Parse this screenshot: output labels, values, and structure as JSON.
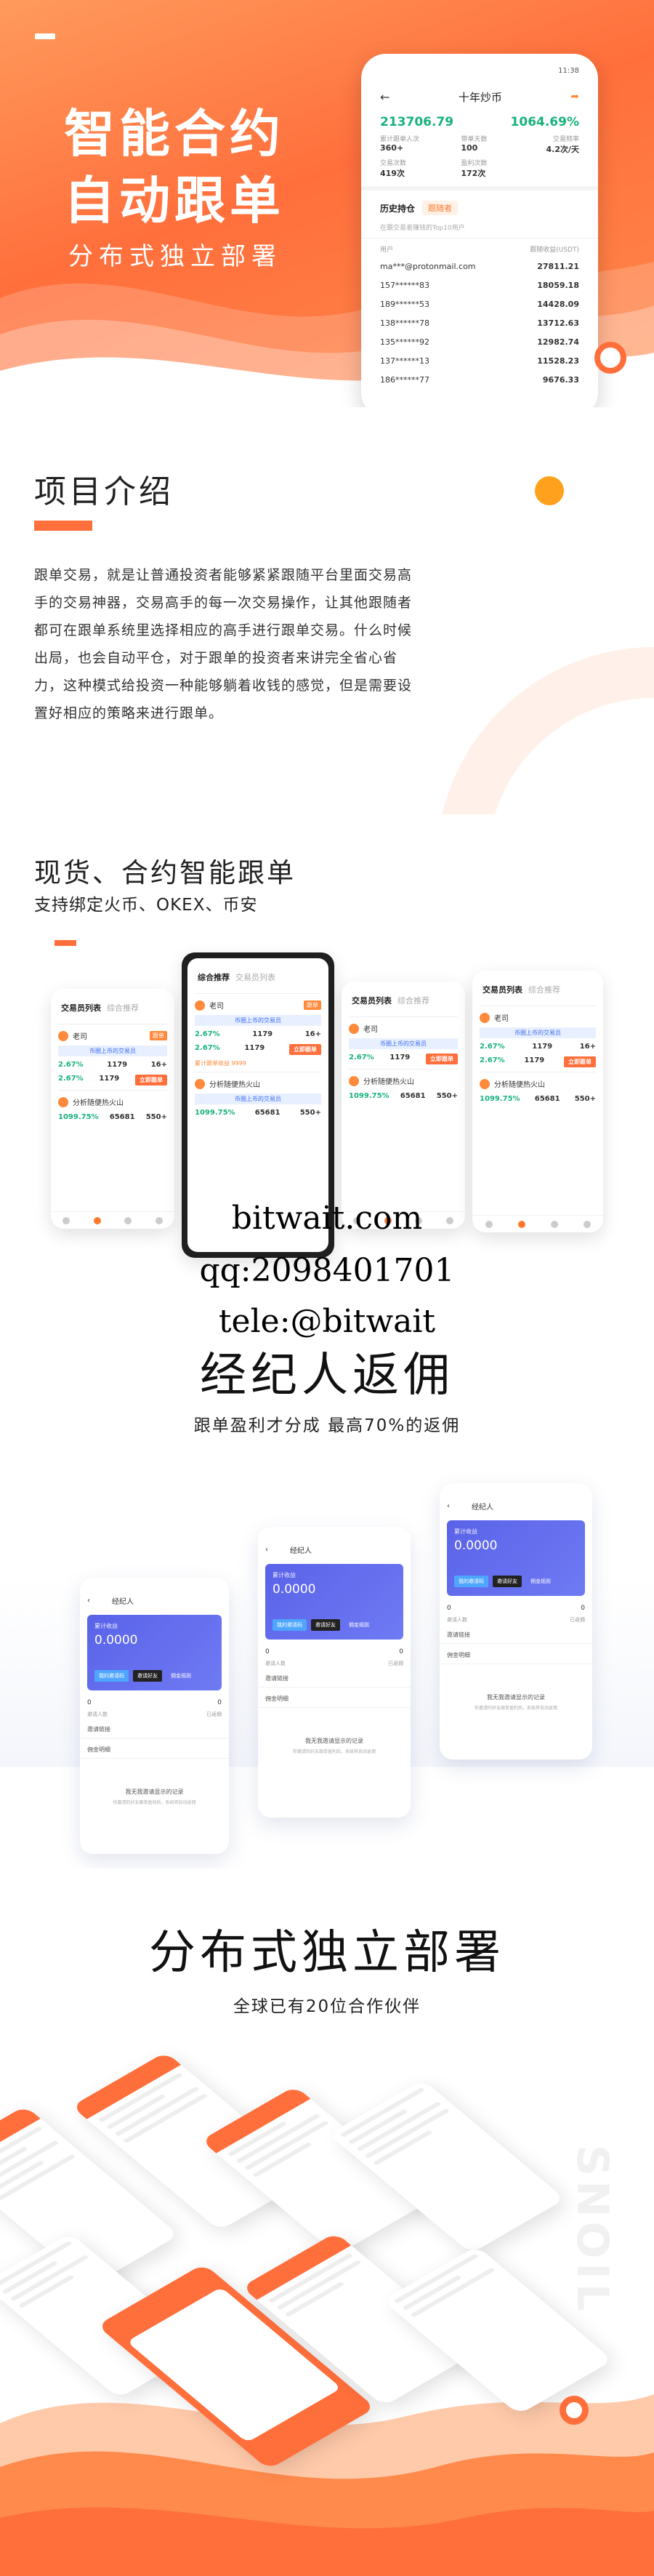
{
  "hero": {
    "title_line1": "智能合约",
    "title_line2": "自动跟单",
    "subtitle": "分布式独立部署",
    "phone": {
      "status_left": "",
      "status_right": "11:38",
      "nav_title": "十年炒币",
      "main_left": "213706.79",
      "main_right": "1064.69%",
      "stats": [
        {
          "label": "累计跟单人次",
          "value": "360+"
        },
        {
          "label": "带单天数",
          "value": "100"
        },
        {
          "label": "交易频率",
          "value": "4.2次/天"
        },
        {
          "label": "交易次数",
          "value": "419次"
        },
        {
          "label": "盈利次数",
          "value": "172次"
        },
        {
          "label": "",
          "value": ""
        }
      ],
      "tab_history": "历史持仓",
      "tab_follow": "跟随者",
      "note": "在跟交易者赚钱的Top10用户",
      "col_user": "用户",
      "col_amount": "跟随收益(USDT)",
      "rows": [
        {
          "user": "ma***@protonmail.com",
          "value": "27811.21"
        },
        {
          "user": "157******83",
          "value": "18059.18"
        },
        {
          "user": "189******53",
          "value": "14428.09"
        },
        {
          "user": "138******78",
          "value": "13712.63"
        },
        {
          "user": "135******92",
          "value": "12982.74"
        },
        {
          "user": "137******13",
          "value": "11528.23"
        },
        {
          "user": "186******77",
          "value": "9676.33"
        }
      ]
    }
  },
  "intro": {
    "title": "项目介绍",
    "body": "跟单交易，就是让普通投资者能够紧紧跟随平台里面交易高手的交易神器，交易高手的每一次交易操作，让其他跟随者都可在跟单系统里选择相应的高手进行跟单交易。什么时候出局，也会自动平仓，对于跟单的投资者来讲完全省心省力，这种模式给投资一种能够躺着收钱的感觉，但是需要设置好相应的策略来进行跟单。"
  },
  "smart": {
    "title": "现货、合约智能跟单",
    "subtitle": "支持绑定火币、OKEX、币安",
    "phone": {
      "tab_a": "综合推荐",
      "tab_b": "交易员列表",
      "trader1": "老司",
      "trader2": "分析随便热火山",
      "badge": "跟单",
      "blue_note": "币圈上币的交易员",
      "stat1": "2.67%",
      "stat2": "1179",
      "stat3": "16+",
      "stat4": "1099.75%",
      "stat5": "65681",
      "stat6": "550+",
      "follow_btn": "立即跟单",
      "orange_note": "累计跟单收益 9999"
    }
  },
  "watermark": {
    "line1": "bitwait.com",
    "line2": "qq:2098401701",
    "line3": "tele:@bitwait"
  },
  "broker": {
    "title": "经纪人返佣",
    "subtitle": "跟单盈利才分成 最高70%的返佣",
    "phone": {
      "nav_title": "经纪人",
      "card_label": "累计收益",
      "card_value": "0.0000",
      "btn1": "我的邀请码",
      "btn2": "邀请好友",
      "btn3": "佣金规则",
      "zero": "0",
      "muted": "邀请人数",
      "muted2": "已返佣",
      "line": "邀请链接",
      "line2": "佣金明细",
      "empty": "我无我邀请显示的记录",
      "empty2": "你邀请的好友跟单盈利后，系统将自动返佣"
    }
  },
  "deploy": {
    "title": "分布式独立部署",
    "subtitle": "全球已有20位合作伙伴",
    "vertical_word": "SNOIL"
  },
  "colors": {
    "brand": "#ff6f3c",
    "green": "#19b27b",
    "accent_yellow": "#ffa11c",
    "card_purple": "#5a63e8"
  }
}
